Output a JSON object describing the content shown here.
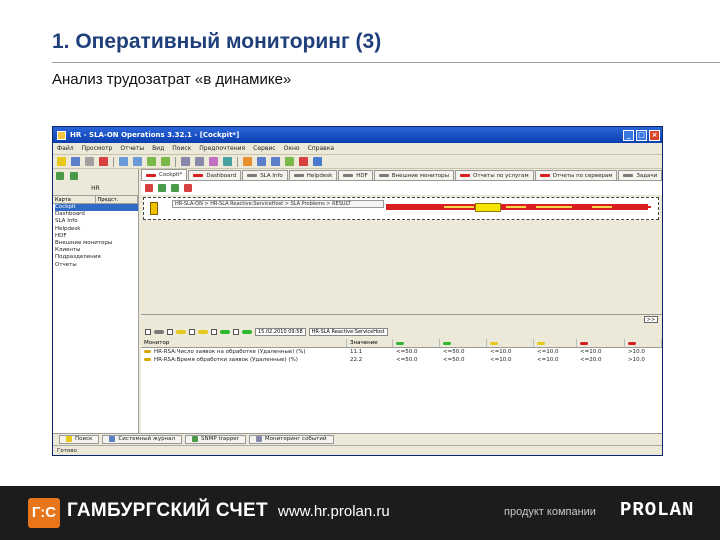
{
  "slide": {
    "title": "1. Оперативный мониторинг (3)",
    "subtitle": "Анализ трудозатрат «в динамике»"
  },
  "window": {
    "title": "HR - SLA-ON Operations 3.32.1 - [Cockpit*]",
    "controls": [
      "_",
      "□",
      "×"
    ],
    "menu": [
      "Файл",
      "Просмотр",
      "Отчеты",
      "Вид",
      "Поиск",
      "Предпочтения",
      "Сервис",
      "Окно",
      "Справка"
    ]
  },
  "left_panel": {
    "caption": "HR",
    "columns": [
      "Карта",
      "Предст."
    ],
    "items": [
      "Cockpit",
      "Dashboard",
      "SLA Info",
      "Helpdesk",
      "HDF",
      "Внешние мониторы",
      "Клиенты",
      "Подразделения",
      "Отчеты"
    ]
  },
  "tabs": [
    {
      "label": "Cockpit*",
      "color": "#d81e1e",
      "active": true
    },
    {
      "label": "Dashboard",
      "color": "#d81e1e"
    },
    {
      "label": "SLA Info",
      "color": "#7a7a7a"
    },
    {
      "label": "Helpdesk",
      "color": "#7a7a7a"
    },
    {
      "label": "HDF",
      "color": "#7a7a7a"
    },
    {
      "label": "Внешние мониторы",
      "color": "#7a7a7a"
    },
    {
      "label": "Отчеты по услугам",
      "color": "#d81e1e"
    },
    {
      "label": "Отчеты по серверам",
      "color": "#d81e1e"
    },
    {
      "label": "Задачи",
      "color": "#7a7a7a"
    }
  ],
  "timeline": {
    "label": "HR-SLA-ON > HR-SLA Reactive:ServiceHost > SLA Problems > RESULT"
  },
  "filter": {
    "value": "15.02.2010 09:58",
    "path": "HR-SLA Reactive:ServiceHost"
  },
  "table": {
    "headers": [
      "Монитор",
      "Значение",
      "",
      "",
      "",
      "",
      "",
      ""
    ],
    "header_colors": [
      "",
      "",
      "#2eb82e",
      "#2eb82e",
      "#e8c81a",
      "#e8c81a",
      "#d81e1e",
      "#d81e1e"
    ],
    "rows": [
      {
        "cells": [
          "HR-RSA:Число заявок на обработке (Удаленные) (%)",
          "11.1",
          "<=50.0",
          "<=50.0",
          "<=10.0",
          "<=10.0",
          "<=10.0",
          ">10.0"
        ]
      },
      {
        "cells": [
          "HR-RSA:Время обработки заявок (Удаленные) (%)",
          "22.2",
          "<=50.0",
          "<=50.0",
          "<=10.0",
          "<=10.0",
          "<=20.0",
          ">10.0"
        ]
      }
    ]
  },
  "bottom_tabs": [
    "Поиск",
    "Системный журнал",
    "SNMP trapper",
    "Мониторинг событий"
  ],
  "status": "Готово",
  "footer": {
    "logo_text": "Г:С",
    "brand": "ГАМБУРГСКИЙ СЧЕТ",
    "site": "www.hr.prolan.ru",
    "product": "продукт компании",
    "company": "PROLAN",
    "accent": "#e8751a"
  }
}
